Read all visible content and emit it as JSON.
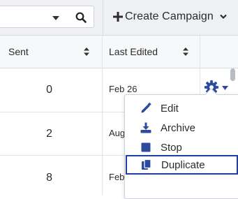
{
  "toolbar": {
    "create_label": "Create Campaign"
  },
  "table": {
    "columns": [
      {
        "label": "Sent"
      },
      {
        "label": "Last Edited"
      }
    ],
    "rows": [
      {
        "sent": "0",
        "last_edited": "Feb 26"
      },
      {
        "sent": "2",
        "last_edited": "Aug"
      },
      {
        "sent": "8",
        "last_edited": "Feb"
      }
    ]
  },
  "menu": {
    "items": [
      {
        "label": "Edit",
        "icon": "pencil-icon"
      },
      {
        "label": "Archive",
        "icon": "download-icon"
      },
      {
        "label": "Stop",
        "icon": "stop-icon"
      },
      {
        "label": "Duplicate",
        "icon": "copy-icon"
      }
    ]
  },
  "colors": {
    "accent": "#1f3fa8",
    "icon": "#2c4a9e",
    "toolbar_bg": "#eef0f3"
  }
}
